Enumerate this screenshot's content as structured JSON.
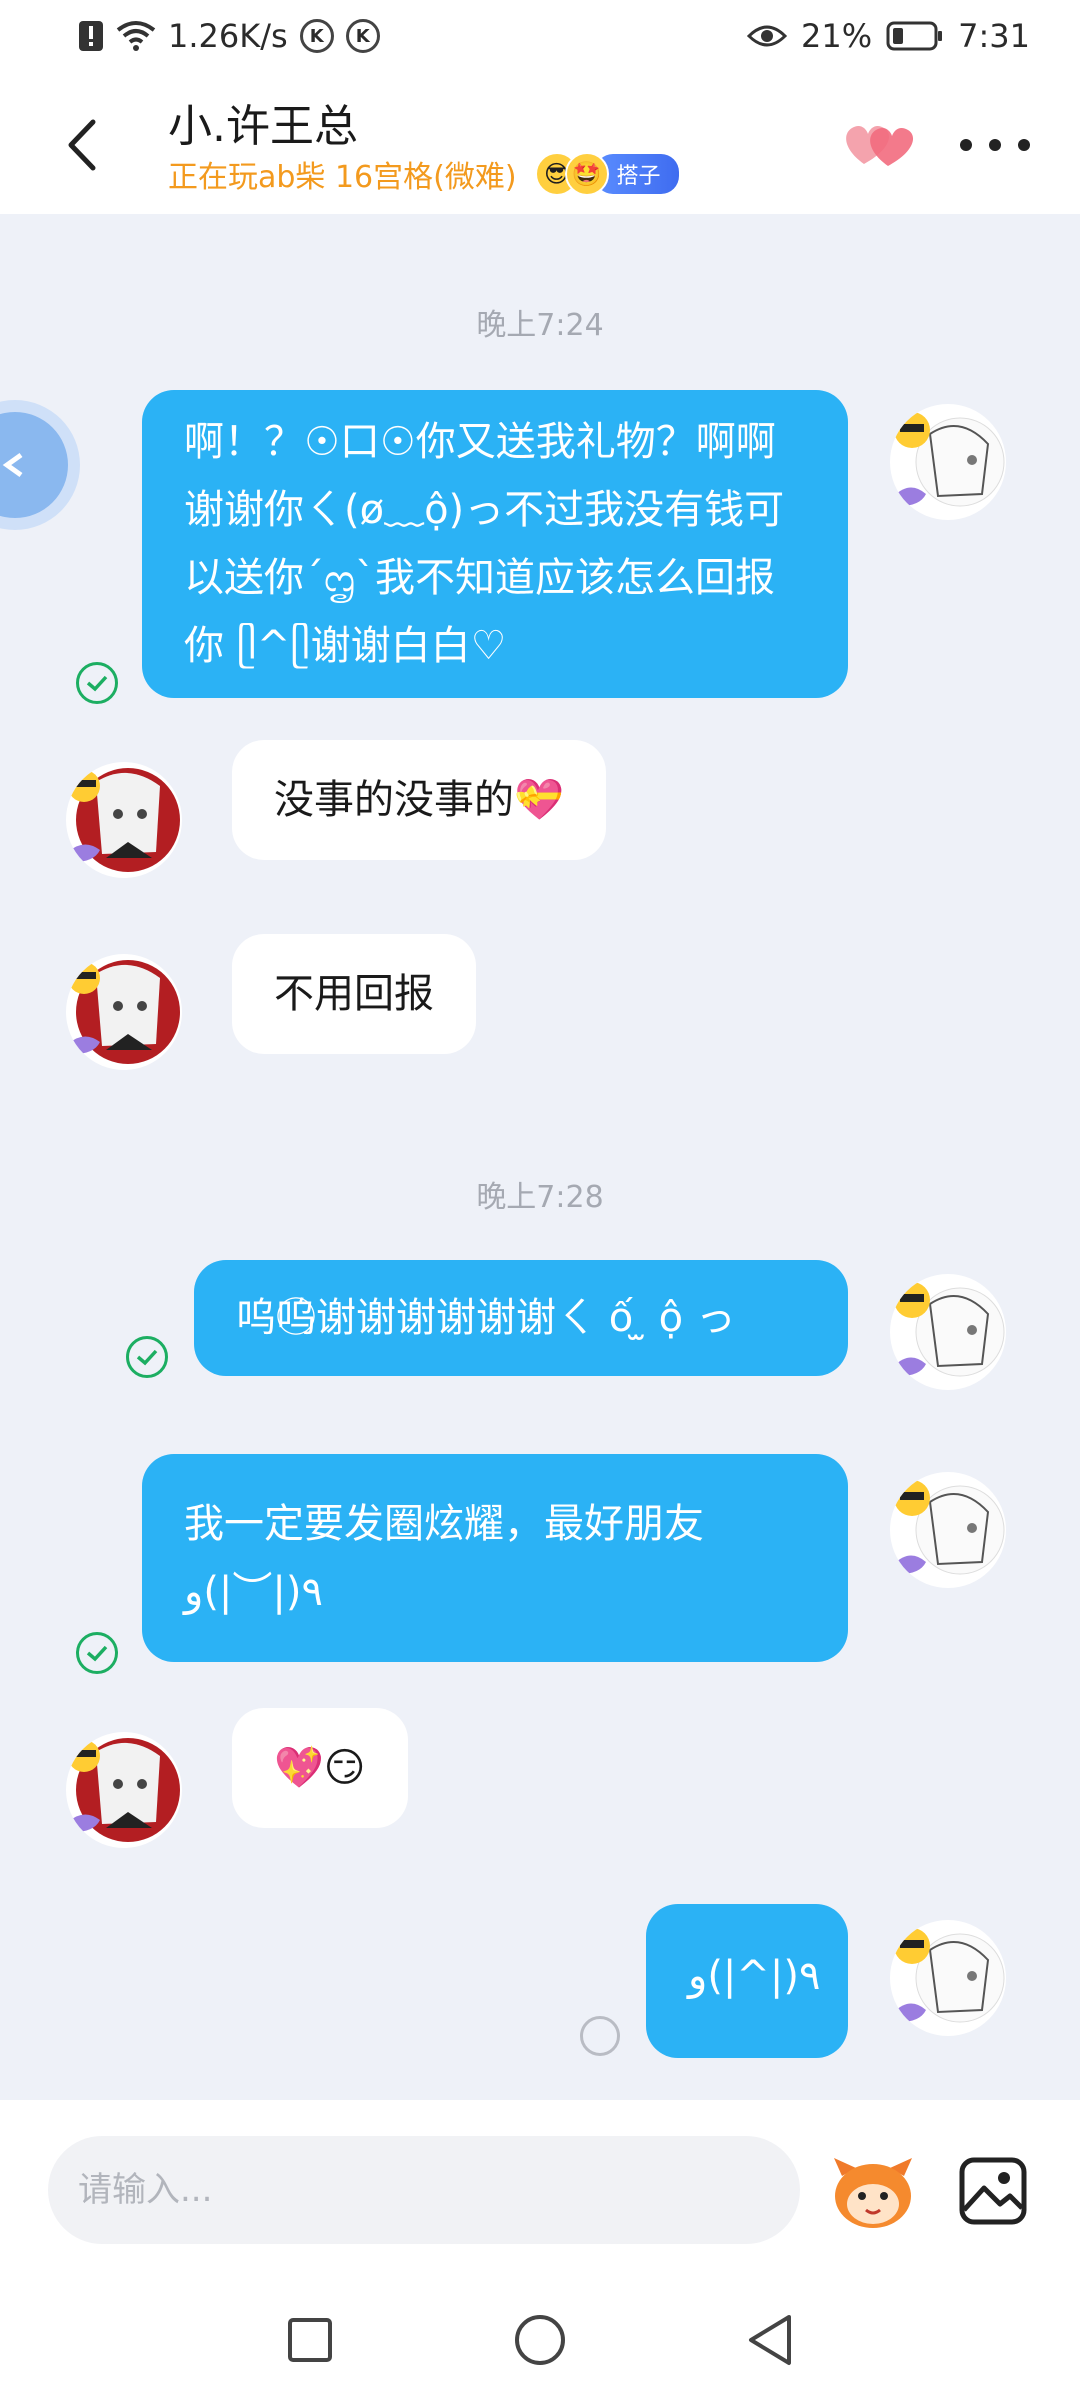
{
  "status_bar": {
    "speed": "1.26K/s",
    "battery_percent": "21%",
    "time": "7:31",
    "k_badge": "K"
  },
  "header": {
    "title": "小.许王总",
    "subtitle": "正在玩ab柴 16宫格(微难)",
    "tag": "搭子",
    "emoji_1": "😎",
    "emoji_2": "🤩"
  },
  "messages": [
    {
      "type": "time",
      "text": "晚上7:24"
    },
    {
      "type": "sent",
      "text": "啊！？☉口☉你又送我礼物？啊啊谢谢你ㄑ(ø﹏ộ)っ不过我没有钱可以送你´ᦗ`我不知道应该怎么回报你 ᥫ^ᥫ谢谢白白♡",
      "status": "read"
    },
    {
      "type": "received",
      "text": "没事的没事的💝"
    },
    {
      "type": "received",
      "text": "不用回报"
    },
    {
      "type": "time",
      "text": "晚上7:28"
    },
    {
      "type": "sent",
      "text": "呜呜⃝谢谢谢谢谢谢ㄑ ố ̫ ộ っ",
      "status": "read"
    },
    {
      "type": "sent",
      "text": "我一定要发圈炫耀，最好朋友٩(|︶|)و",
      "status": "read"
    },
    {
      "type": "received",
      "text": "💖😏"
    },
    {
      "type": "sent",
      "text": "٩(|^|)و",
      "status": "sending"
    }
  ],
  "input": {
    "placeholder": "请输入..."
  },
  "colors": {
    "sent_bubble": "#2bb2f5",
    "received_bubble": "#ffffff",
    "background": "#eef1f8",
    "subtitle": "#f39a1e",
    "read_tick": "#1cae62"
  }
}
